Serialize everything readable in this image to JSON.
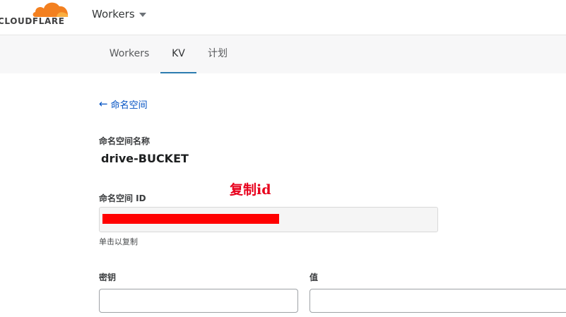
{
  "header": {
    "logo_text": "CLOUDFLARE",
    "account_selector": "Workers",
    "brand_color": "#f38020"
  },
  "tabs": [
    {
      "label": "Workers",
      "active": false
    },
    {
      "label": "KV",
      "active": true
    },
    {
      "label": "计划",
      "active": false
    }
  ],
  "back_link": {
    "label": "命名空间",
    "icon": "arrow-left-icon"
  },
  "namespace": {
    "name_label": "命名空间名称",
    "name": "drive-BUCKET",
    "id_label": "命名空间 ID",
    "id_hint": "单击以复制",
    "id_redacted": true
  },
  "annotation": "复制id",
  "kv_form": {
    "key_label": "密钥",
    "value_label": "值",
    "key_value": "",
    "value_value": ""
  },
  "colors": {
    "link": "#0051c3",
    "tab_active_underline": "#2c7cb0",
    "annotation": "#e8001c",
    "redaction": "#ff0000"
  }
}
